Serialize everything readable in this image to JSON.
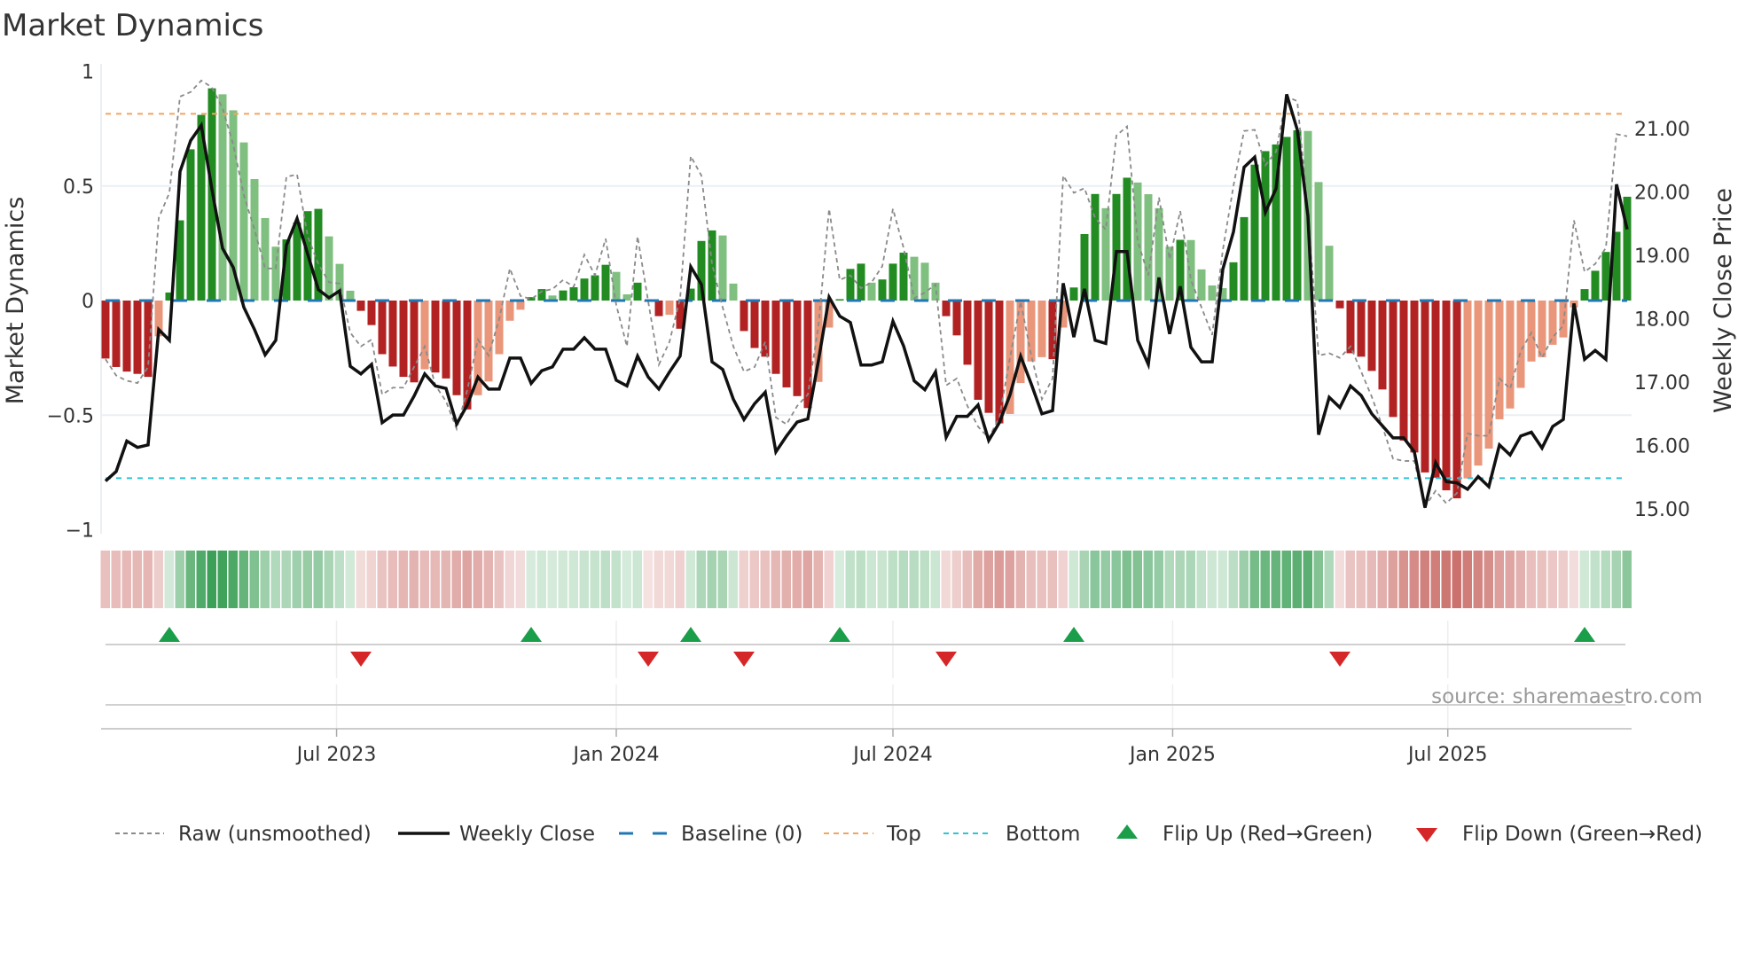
{
  "page": {
    "title": "Market Dynamics",
    "source": "source: sharemaestro.com"
  },
  "legend": [
    {
      "label": "Raw (unsmoothed)",
      "kind": "raw"
    },
    {
      "label": "Weekly Close",
      "kind": "close"
    },
    {
      "label": "Baseline (0)",
      "kind": "baseline"
    },
    {
      "label": "Top",
      "kind": "top"
    },
    {
      "label": "Bottom",
      "kind": "bottom"
    },
    {
      "label": "Flip Up (Red→Green)",
      "kind": "flip-up"
    },
    {
      "label": "Flip Down (Green→Red)",
      "kind": "flip-down"
    }
  ],
  "colors": {
    "pos_strong": "#228b22",
    "pos_weak": "#7fbf7f",
    "neg_strong": "#b22222",
    "neg_weak": "#e9967a",
    "baseline": "#1f77b4",
    "top": "#f4a460",
    "bottom": "#2ec4d6",
    "raw": "#8a8a8a",
    "close": "#111111",
    "flip_up": "#1a9e4a",
    "flip_down": "#d62728",
    "grid": "#eceff3"
  },
  "chart_data": {
    "type": "bar",
    "title": "Market Dynamics",
    "ylabel": "Market Dynamics",
    "y2label": "Weekly Close Price",
    "ylim": [
      -1,
      1
    ],
    "y2lim": [
      14.66,
      21.9
    ],
    "yticks": [
      {
        "value": 1,
        "label": "1"
      },
      {
        "value": 0.5,
        "label": "0.5"
      },
      {
        "value": 0,
        "label": "0"
      },
      {
        "value": -0.5,
        "label": "−0.5"
      },
      {
        "value": -1,
        "label": "−1"
      }
    ],
    "y2ticks": [
      {
        "value": 21,
        "label": "21.00"
      },
      {
        "value": 20,
        "label": "20.00"
      },
      {
        "value": 19,
        "label": "19.00"
      },
      {
        "value": 18,
        "label": "18.00"
      },
      {
        "value": 17,
        "label": "17.00"
      },
      {
        "value": 16,
        "label": "16.00"
      },
      {
        "value": 15,
        "label": "15.00"
      }
    ],
    "xticks": [
      {
        "date": "2023-07-01",
        "label": "Jul 2023"
      },
      {
        "date": "2024-01-01",
        "label": "Jan 2024"
      },
      {
        "date": "2024-07-01",
        "label": "Jul 2024"
      },
      {
        "date": "2025-01-01",
        "label": "Jan 2025"
      },
      {
        "date": "2025-07-01",
        "label": "Jul 2025"
      }
    ],
    "x_start": "2023-01-30",
    "x_step_days": 7,
    "levels": {
      "top": 0.815,
      "bottom": -0.775,
      "baseline": 0
    },
    "flip_up_weeks": [
      7,
      41,
      56,
      70,
      92,
      140
    ],
    "flip_down_weeks": [
      25,
      52,
      61,
      80,
      117
    ],
    "series": [
      {
        "name": "Market Dynamics",
        "kind": "bars",
        "values": [
          -0.253,
          -0.29,
          -0.31,
          -0.32,
          -0.333,
          -0.156,
          0.035,
          0.35,
          0.66,
          0.81,
          0.926,
          0.9,
          0.83,
          0.69,
          0.53,
          0.36,
          0.235,
          0.267,
          0.34,
          0.39,
          0.4,
          0.28,
          0.16,
          0.043,
          -0.045,
          -0.107,
          -0.234,
          -0.288,
          -0.333,
          -0.357,
          -0.3,
          -0.314,
          -0.34,
          -0.413,
          -0.475,
          -0.413,
          -0.353,
          -0.234,
          -0.088,
          -0.04,
          0.015,
          0.05,
          0.022,
          0.044,
          0.058,
          0.096,
          0.11,
          0.156,
          0.125,
          0.027,
          0.078,
          -0.005,
          -0.068,
          -0.062,
          -0.123,
          0.052,
          0.26,
          0.306,
          0.284,
          0.074,
          -0.133,
          -0.207,
          -0.245,
          -0.32,
          -0.379,
          -0.417,
          -0.469,
          -0.355,
          -0.118,
          0.006,
          0.138,
          0.161,
          0.078,
          0.092,
          0.161,
          0.209,
          0.191,
          0.165,
          0.078,
          -0.068,
          -0.152,
          -0.28,
          -0.433,
          -0.49,
          -0.536,
          -0.495,
          -0.36,
          -0.266,
          -0.247,
          -0.256,
          -0.118,
          0.057,
          0.29,
          0.465,
          0.403,
          0.465,
          0.536,
          0.515,
          0.464,
          0.403,
          0.235,
          0.265,
          0.264,
          0.136,
          0.066,
          0.054,
          0.167,
          0.364,
          0.593,
          0.652,
          0.681,
          0.714,
          0.743,
          0.74,
          0.517,
          0.239,
          -0.034,
          -0.23,
          -0.245,
          -0.307,
          -0.388,
          -0.508,
          -0.611,
          -0.663,
          -0.75,
          -0.773,
          -0.828,
          -0.863,
          -0.776,
          -0.72,
          -0.646,
          -0.518,
          -0.471,
          -0.381,
          -0.266,
          -0.247,
          -0.193,
          -0.161,
          -0.03,
          0.05,
          0.13,
          0.212,
          0.3,
          0.453
        ]
      },
      {
        "name": "Raw (unsmoothed)",
        "kind": "raw",
        "values": [
          -0.256,
          -0.327,
          -0.35,
          -0.36,
          -0.29,
          0.36,
          0.47,
          0.89,
          0.91,
          0.96,
          0.93,
          0.84,
          0.68,
          0.46,
          0.31,
          0.14,
          0.14,
          0.54,
          0.55,
          0.28,
          0.16,
          0.08,
          0.074,
          -0.14,
          -0.2,
          -0.17,
          -0.41,
          -0.38,
          -0.38,
          -0.29,
          -0.2,
          -0.37,
          -0.44,
          -0.56,
          -0.39,
          -0.17,
          -0.24,
          -0.08,
          0.14,
          0.02,
          0.006,
          0.04,
          0.05,
          0.09,
          0.06,
          0.2,
          0.11,
          0.27,
          -0.02,
          -0.2,
          0.28,
          -0.004,
          -0.28,
          -0.18,
          0.01,
          0.63,
          0.545,
          0.16,
          -0.03,
          -0.2,
          -0.31,
          -0.29,
          -0.18,
          -0.51,
          -0.54,
          -0.46,
          -0.41,
          -0.11,
          0.4,
          0.09,
          0.11,
          0.054,
          0.08,
          0.15,
          0.4,
          0.23,
          0.01,
          0.035,
          0.07,
          -0.37,
          -0.34,
          -0.46,
          -0.55,
          -0.6,
          -0.51,
          -0.25,
          -0.004,
          -0.24,
          -0.43,
          -0.34,
          0.545,
          0.47,
          0.49,
          0.36,
          0.31,
          0.72,
          0.76,
          0.26,
          0.11,
          0.45,
          0.18,
          0.39,
          0.09,
          -0.03,
          -0.15,
          0.22,
          0.5,
          0.74,
          0.745,
          0.59,
          0.65,
          0.89,
          0.87,
          0.39,
          -0.24,
          -0.23,
          -0.25,
          -0.2,
          -0.31,
          -0.42,
          -0.55,
          -0.69,
          -0.7,
          -0.7,
          -0.9,
          -0.83,
          -0.885,
          -0.84,
          -0.58,
          -0.59,
          -0.59,
          -0.34,
          -0.385,
          -0.22,
          -0.14,
          -0.25,
          -0.16,
          -0.11,
          0.35,
          0.125,
          0.16,
          0.23,
          0.726,
          0.717
        ]
      },
      {
        "name": "Weekly Close",
        "kind": "close",
        "axis": "right",
        "values": [
          15.44,
          15.59,
          16.07,
          15.97,
          16.01,
          17.83,
          17.66,
          20.32,
          20.81,
          21.05,
          20.04,
          19.11,
          18.81,
          18.18,
          17.83,
          17.43,
          17.66,
          19.16,
          19.58,
          19.02,
          18.46,
          18.33,
          18.44,
          17.25,
          17.13,
          17.28,
          16.36,
          16.48,
          16.48,
          16.78,
          17.13,
          16.94,
          16.9,
          16.34,
          16.64,
          17.08,
          16.89,
          16.89,
          17.38,
          17.38,
          16.98,
          17.18,
          17.24,
          17.52,
          17.52,
          17.7,
          17.52,
          17.52,
          17.03,
          16.94,
          17.41,
          17.08,
          16.89,
          17.16,
          17.41,
          18.82,
          18.54,
          17.32,
          17.2,
          16.73,
          16.41,
          16.66,
          16.84,
          15.9,
          16.15,
          16.37,
          16.42,
          17.34,
          18.34,
          18.04,
          17.94,
          17.27,
          17.27,
          17.32,
          17.96,
          17.57,
          17.02,
          16.88,
          17.16,
          16.13,
          16.46,
          16.46,
          16.64,
          16.08,
          16.36,
          16.8,
          17.41,
          16.97,
          16.5,
          16.55,
          18.56,
          17.71,
          18.47,
          17.66,
          17.61,
          19.06,
          19.06,
          17.66,
          17.28,
          18.65,
          17.76,
          18.51,
          17.55,
          17.32,
          17.32,
          18.78,
          19.37,
          20.39,
          20.55,
          19.68,
          20.05,
          21.54,
          20.98,
          19.62,
          16.17,
          16.76,
          16.6,
          16.94,
          16.79,
          16.5,
          16.31,
          16.12,
          16.12,
          15.9,
          15.02,
          15.73,
          15.43,
          15.41,
          15.31,
          15.51,
          15.35,
          16.01,
          15.85,
          16.15,
          16.21,
          15.96,
          16.3,
          16.41,
          18.24,
          17.36,
          17.5,
          17.36,
          20.12,
          19.41
        ]
      }
    ]
  }
}
